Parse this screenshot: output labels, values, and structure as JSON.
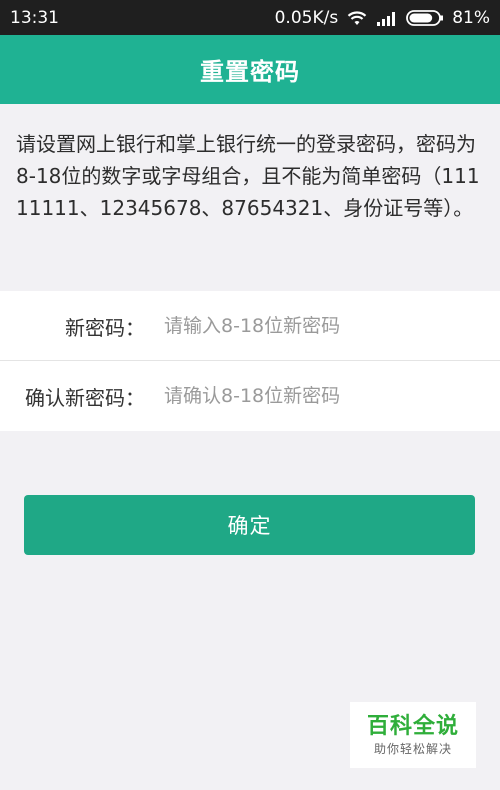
{
  "status_bar": {
    "time": "13:31",
    "network_speed": "0.05K/s",
    "battery": "81%",
    "battery_level": 0.81,
    "icons": [
      "wifi-icon",
      "signal-icon",
      "battery-icon"
    ]
  },
  "header": {
    "title": "重置密码"
  },
  "instructions": {
    "text": "请设置网上银行和掌上银行统一的登录密码，密码为8-18位的数字或字母组合，且不能为简单密码（11111111、12345678、87654321、身份证号等）。"
  },
  "form": {
    "new_password": {
      "label": "新密码：",
      "placeholder": "请输入8-18位新密码",
      "value": ""
    },
    "confirm_password": {
      "label": "确认新密码：",
      "placeholder": "请确认8-18位新密码",
      "value": ""
    }
  },
  "confirm_button": {
    "label": "确定"
  },
  "watermark": {
    "title": "百科全说",
    "subtitle": "助你轻松解决"
  },
  "colors": {
    "accent": "#1fb293",
    "button": "#1fa886",
    "background": "#f2f1f4",
    "status_bar": "#1f1f1f"
  }
}
